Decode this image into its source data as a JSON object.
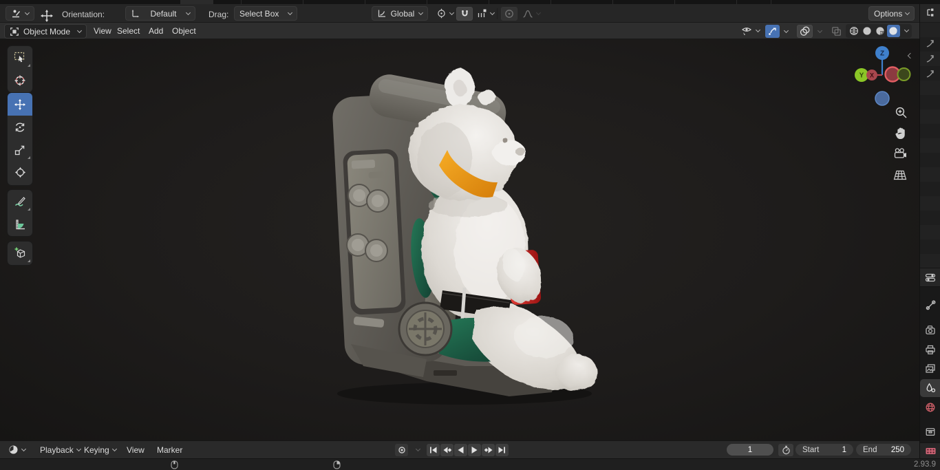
{
  "app": {
    "version": "2.93.9"
  },
  "topbar": {
    "orientation_label": "Orientation:",
    "orientation_value": "Default",
    "drag_label": "Drag:",
    "drag_value": "Select Box",
    "transform_space": "Global",
    "options_label": "Options"
  },
  "viewport_header": {
    "mode": "Object Mode",
    "menus": [
      "View",
      "Select",
      "Add",
      "Object"
    ],
    "shading": {
      "modes": [
        "wireframe",
        "solid",
        "material-preview",
        "rendered"
      ],
      "active": "rendered"
    }
  },
  "left_toolbar": {
    "tools": [
      "select-box",
      "cursor",
      "move",
      "rotate",
      "scale",
      "transform",
      "annotate",
      "measure",
      "add-cube"
    ],
    "active_tool": "move"
  },
  "gizmo": {
    "x": "X",
    "y": "Y",
    "z": "Z"
  },
  "right_column": {
    "editors": [
      "outliner",
      "properties",
      "video-sequencer"
    ],
    "properties_tabs": [
      "tool",
      "render",
      "output",
      "view-layer",
      "scene",
      "world",
      "collection"
    ],
    "active_tab": "scene"
  },
  "timeline": {
    "menus": [
      "Playback",
      "Keying",
      "View",
      "Marker"
    ],
    "current_frame": "1",
    "start_label": "Start",
    "start_value": "1",
    "end_label": "End",
    "end_value": "250"
  },
  "icons": {
    "timeline_editor": "clock",
    "outliner_editor": "tree",
    "properties_editor": "sliders",
    "sequencer_editor": "film-strip",
    "statusbar_left": "mouse-left-button",
    "statusbar_right": "mouse-right-button"
  },
  "colors": {
    "accent": "#4772b3",
    "axis_x": "#e25e63",
    "axis_y": "#8bc627",
    "axis_z": "#3f80cc",
    "scarf": "#eda21f",
    "cushion": "#1e6a50",
    "can": "#cf2026",
    "world_tab": "#ca5d66",
    "film_tab": "#d4687a"
  }
}
